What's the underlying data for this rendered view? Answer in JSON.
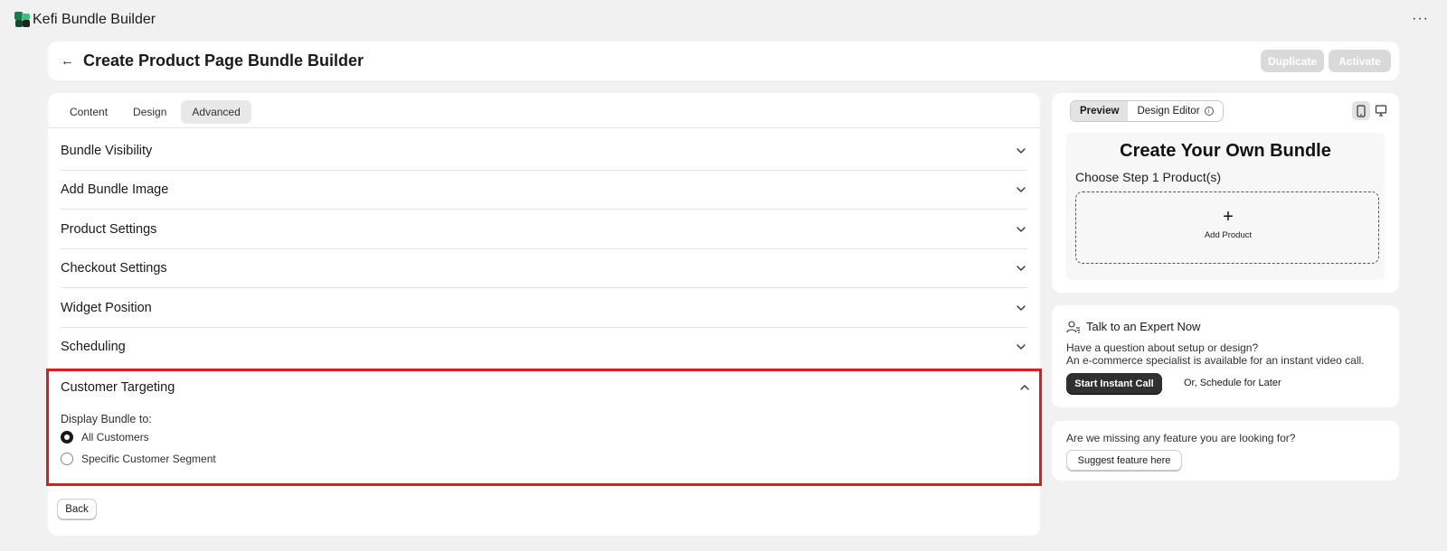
{
  "app": {
    "title": "Kefi Bundle Builder",
    "more_icon": "···"
  },
  "header": {
    "back_icon": "←",
    "title": "Create Product Page Bundle Builder",
    "duplicate_label": "Duplicate",
    "activate_label": "Activate"
  },
  "tabs": [
    {
      "label": "Content",
      "active": false
    },
    {
      "label": "Design",
      "active": false
    },
    {
      "label": "Advanced",
      "active": true
    }
  ],
  "sections": [
    {
      "title": "Bundle Visibility"
    },
    {
      "title": "Add Bundle Image"
    },
    {
      "title": "Product Settings"
    },
    {
      "title": "Checkout Settings"
    },
    {
      "title": "Widget Position"
    },
    {
      "title": "Scheduling"
    }
  ],
  "targeting": {
    "title": "Customer Targeting",
    "display_label": "Display Bundle to:",
    "options": [
      {
        "label": "All Customers",
        "selected": true
      },
      {
        "label": "Specific Customer Segment",
        "selected": false
      }
    ]
  },
  "footer": {
    "back_label": "Back"
  },
  "preview": {
    "preview_tab": "Preview",
    "design_editor_tab": "Design Editor",
    "info_icon": "i",
    "bundle_title": "Create Your Own Bundle",
    "step_label": "Choose Step 1 Product(s)",
    "add_plus": "+",
    "add_label": "Add Product"
  },
  "expert": {
    "title": "Talk to an Expert Now",
    "line1": "Have a question about setup or design?",
    "line2": "An e-commerce specialist is available for an instant video call.",
    "call_label": "Start Instant Call",
    "schedule_label": "Or, Schedule for Later"
  },
  "feature": {
    "text": "Are we missing any feature you are looking for?",
    "suggest_label": "Suggest feature here"
  },
  "colors": {
    "highlight": "#e01b1b",
    "primary_button": "#303030",
    "disabled_button": "#d9d9d9",
    "background": "#f1f1f1"
  }
}
